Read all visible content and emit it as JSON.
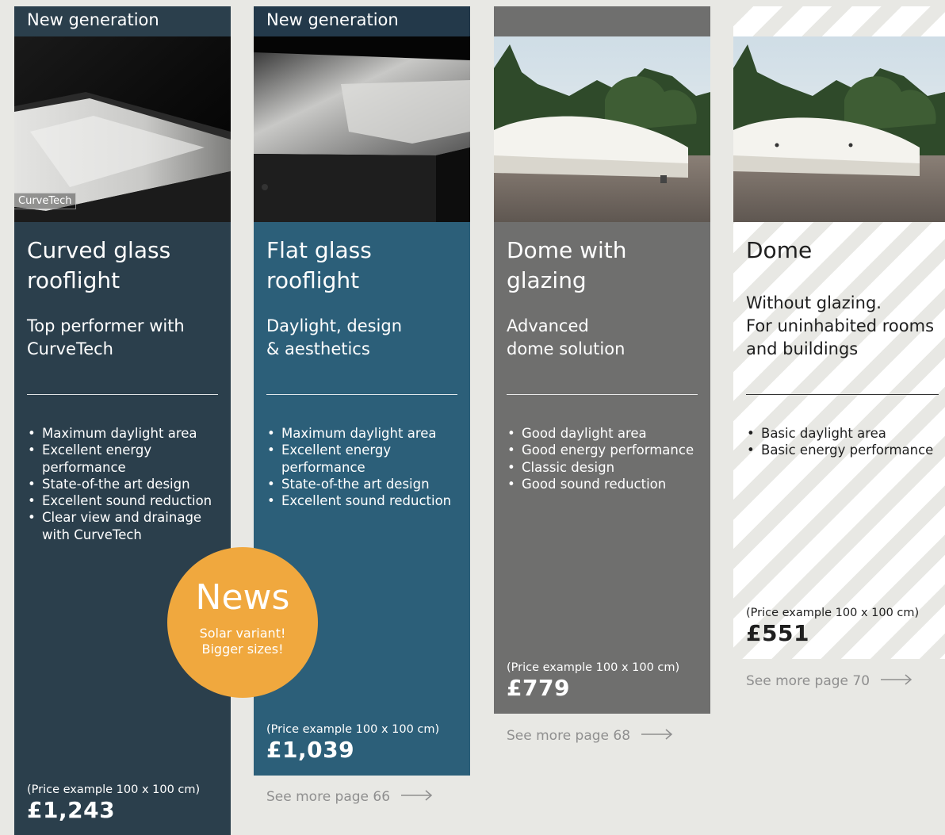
{
  "cards": [
    {
      "tag": "New generation",
      "title": [
        "Curved glass",
        "rooflight"
      ],
      "subtitle": [
        "Top performer with",
        "CurveTech"
      ],
      "features": [
        "Maximum daylight area",
        "Excellent energy performance",
        "State-of-the art design",
        "Excellent sound reduction",
        "Clear view and drainage with CurveTech"
      ],
      "price_note": "(Price example 100 x 100 cm)",
      "price": "£1,243",
      "photo_logo": "CurveTech",
      "color": "#2b3f4c"
    },
    {
      "tag": "New generation",
      "title": [
        "Flat glass",
        "rooflight"
      ],
      "subtitle": [
        "Daylight, design",
        "& aesthetics"
      ],
      "features": [
        "Maximum daylight area",
        "Excellent energy performance",
        "State-of-the art design",
        "Excellent sound reduction"
      ],
      "price_note": "(Price example 100 x 100 cm)",
      "price": "£1,039",
      "see_more": "See more page 66",
      "color": "#2c5f79"
    },
    {
      "tag": "",
      "title": [
        "Dome with",
        "glazing"
      ],
      "subtitle": [
        "Advanced",
        "dome solution"
      ],
      "features": [
        "Good daylight area",
        "Good energy performance",
        "Classic design",
        "Good sound reduction"
      ],
      "price_note": "(Price example 100 x 100 cm)",
      "price": "£779",
      "see_more": "See more page 68",
      "color": "#6f6f6e"
    },
    {
      "tag": "",
      "title": [
        "Dome"
      ],
      "subtitle": [
        "Without glazing.",
        "For uninhabited rooms",
        "and buildings"
      ],
      "features": [
        "Basic daylight area",
        "Basic energy performance"
      ],
      "price_note": "(Price example 100 x 100 cm)",
      "price": "£551",
      "see_more": "See more page 70",
      "color": "#ffffff"
    }
  ],
  "news_badge": {
    "title": "News",
    "lines": [
      "Solar variant!",
      "Bigger sizes!"
    ],
    "color": "#f0a83e"
  },
  "icons": [
    "arrow-right-icon"
  ]
}
